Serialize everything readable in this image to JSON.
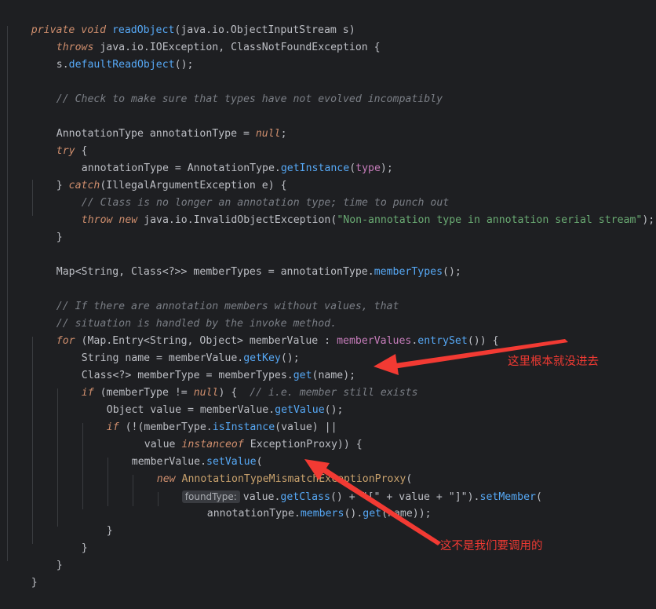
{
  "code": {
    "l1": [
      "private void ",
      "readObject",
      "(java.io.ObjectInputStream s)"
    ],
    "l2": [
      "throws ",
      "java.io.IOException, ClassNotFoundException {"
    ],
    "l3": [
      "s.",
      "defaultReadObject",
      "();"
    ],
    "l5": "// Check to make sure that types have not evolved incompatibly",
    "l7": [
      "AnnotationType annotationType = ",
      "null",
      ";"
    ],
    "l8": [
      "try",
      " {"
    ],
    "l9": [
      "annotationType = AnnotationType.",
      "getInstance",
      "(",
      "type",
      ");"
    ],
    "l10": [
      "} ",
      "catch",
      "(IllegalArgumentException e) {"
    ],
    "l11": "// Class is no longer an annotation type; time to punch out",
    "l12": [
      "throw new ",
      "java.io.InvalidObjectException(",
      "\"Non-annotation type in annotation serial stream\"",
      ");"
    ],
    "l13": "}",
    "l15": [
      "Map<String, Class<?>> memberTypes = annotationType.",
      "memberTypes",
      "();"
    ],
    "l17": "// If there are annotation members without values, that",
    "l18": "// situation is handled by the invoke method.",
    "l19": [
      "for",
      " (Map.Entry<String, Object> memberValue : ",
      "memberValues",
      ".",
      "entrySet",
      "()) {"
    ],
    "l20": [
      "String name = memberValue.",
      "getKey",
      "();"
    ],
    "l21": [
      "Class<?> memberType = memberTypes.",
      "get",
      "(name);"
    ],
    "l22": [
      "if",
      " (memberType != ",
      "null",
      ") {  ",
      "// i.e. member still exists"
    ],
    "l23": [
      "Object value = memberValue.",
      "getValue",
      "();"
    ],
    "l24": [
      "if",
      " (!(memberType.",
      "isInstance",
      "(value) ||"
    ],
    "l25": [
      "value ",
      "instanceof",
      " ExceptionProxy)) {"
    ],
    "l26": [
      "memberValue.",
      "setValue",
      "("
    ],
    "l27": [
      "new ",
      "AnnotationTypeMismatchExceptionProxy",
      "("
    ],
    "l28": [
      "foundType:",
      "value.",
      "getClass",
      "() + \"[\" + value + \"]\").",
      "setMember",
      "("
    ],
    "l29": [
      "annotationType.",
      "members",
      "().",
      "get",
      "(name));"
    ],
    "l30": "}",
    "l31": "}",
    "l32": "}",
    "l33": "}"
  },
  "annotations": {
    "note1": "这里根本就没进去",
    "note2": "这不是我们要调用的"
  },
  "colors": {
    "background": "#1e1f22",
    "keyword": "#cf8e6d",
    "method": "#56a8f5",
    "field": "#c77dbb",
    "string": "#6aab73",
    "comment": "#7a7e85",
    "annotation_red": "#f23a33"
  }
}
